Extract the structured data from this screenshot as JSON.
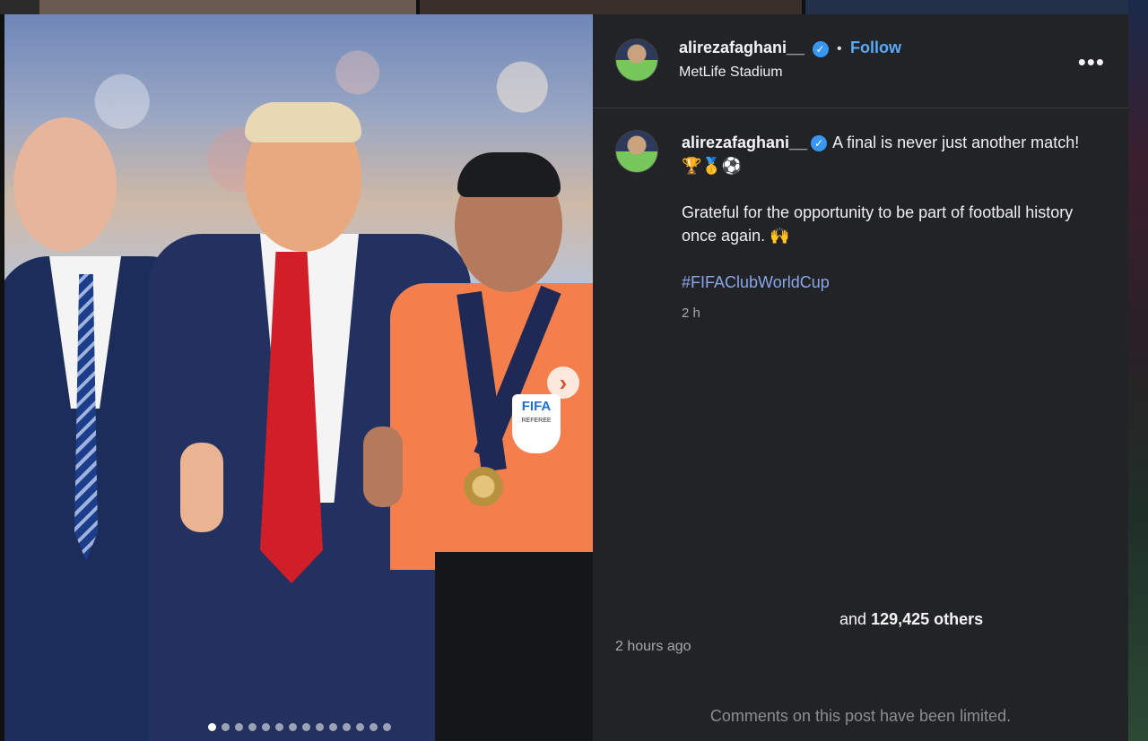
{
  "post": {
    "author": "alirezafaghani__",
    "verified_icon": "verified-badge-icon",
    "separator": "•",
    "follow_label": "Follow",
    "location": "MetLife Stadium",
    "more_icon": "more-options-icon",
    "more_glyph": "•••",
    "caption_line1": "A final is never just another match! 🏆🥇⚽",
    "caption_line2": "Grateful for the opportunity to be part of football history once again. 🙌",
    "hashtag": "#FIFAClubWorldCup",
    "caption_age": "2 h",
    "likes_prefix": "and",
    "likes_count": "129,425 others",
    "timestamp": "2 hours ago",
    "comments_notice": "Comments on this post have been limited."
  },
  "media": {
    "next_icon": "chevron-right-icon",
    "next_glyph": "›",
    "carousel_count": 14,
    "carousel_active": 1,
    "badge_text": "FIFA",
    "badge_sub": "REFEREE"
  },
  "colors": {
    "panel_bg": "#222326",
    "link": "#5aa9f5",
    "hashtag": "#8ba6e8",
    "referee_shirt": "#f47e4c"
  }
}
